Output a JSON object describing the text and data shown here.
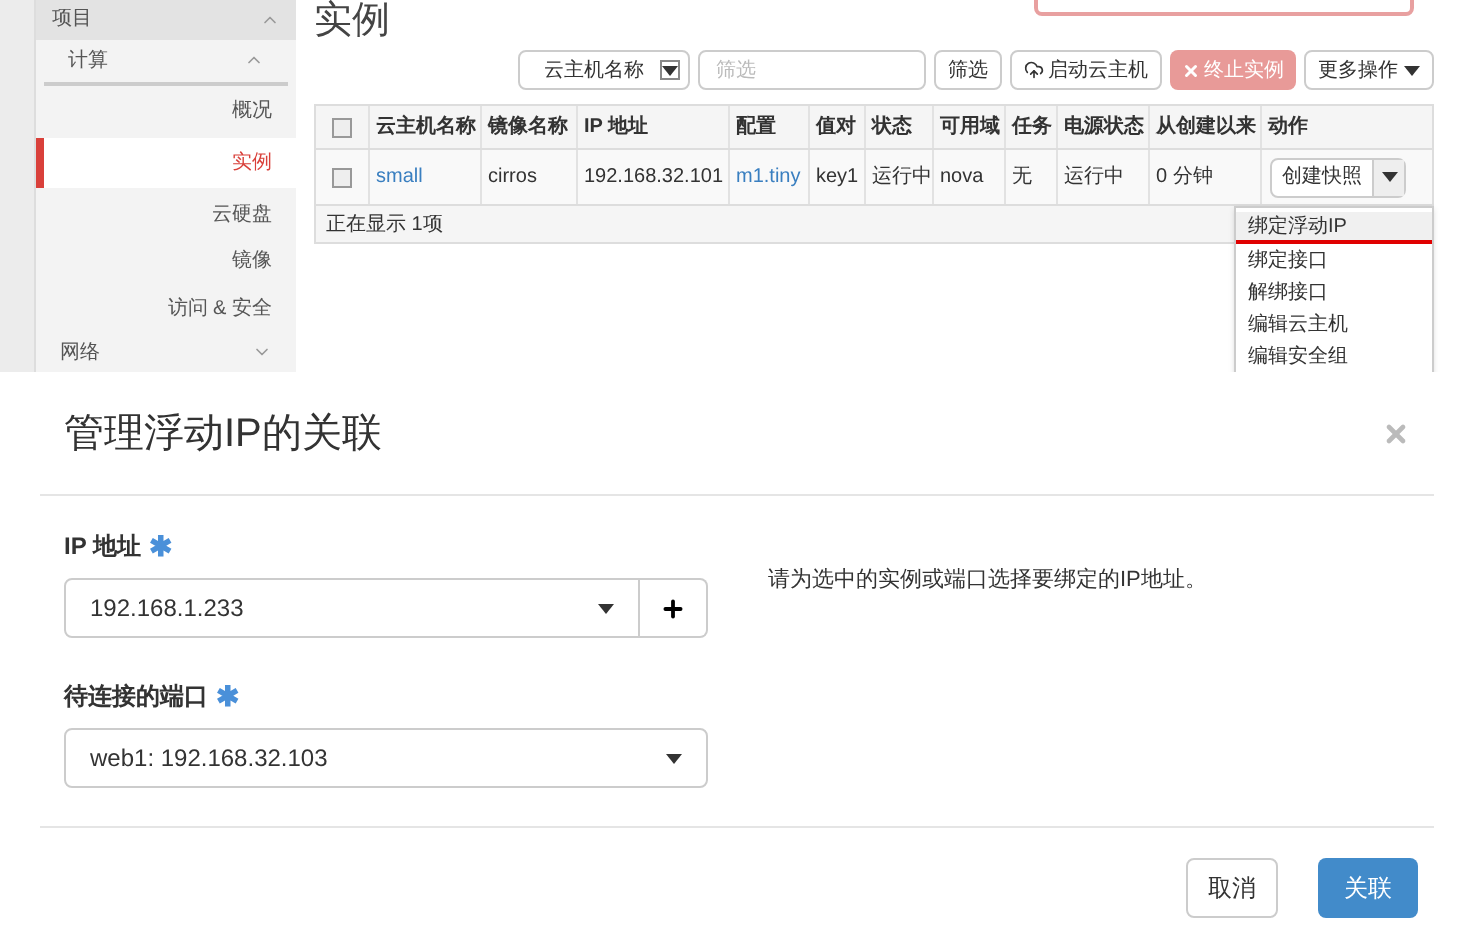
{
  "sidebar": {
    "label": "项目",
    "expanded": true,
    "children": [
      {
        "label": "计算",
        "expanded": true,
        "children": [
          {
            "label": "概况",
            "selected": false
          },
          {
            "label": "实例",
            "selected": true
          },
          {
            "label": "云硬盘",
            "selected": false
          },
          {
            "label": "镜像",
            "selected": false
          },
          {
            "label": "访问 & 安全",
            "selected": false
          }
        ]
      },
      {
        "label": "网络",
        "expanded": false
      }
    ]
  },
  "page_title": "实例",
  "toolbar": {
    "filter_field_select": "云主机名称",
    "filter_placeholder": "筛选",
    "filter_button": "筛选",
    "launch_button": "启动云主机",
    "terminate_button": {
      "label": "终止实例",
      "disabled": true
    },
    "more_button": "更多操作"
  },
  "table": {
    "all_checked": false,
    "columns": [
      "云主机名称",
      "镜像名称",
      "IP 地址",
      "配置",
      "值对",
      "状态",
      "可用域",
      "任务",
      "电源状态",
      "从创建以来",
      "动作"
    ],
    "rows": [
      {
        "checked": false,
        "cells": [
          "small",
          "cirros",
          "192.168.32.101",
          "m1.tiny",
          "key1",
          "运行中",
          "nova",
          "无",
          "运行中",
          "0 分钟"
        ],
        "action": "创建快照"
      }
    ],
    "footer": "正在显示 1项"
  },
  "action_menu": [
    {
      "label": "绑定浮动IP",
      "highlighted": true
    },
    {
      "label": "绑定接口",
      "highlighted": false
    },
    {
      "label": "解绑接口",
      "highlighted": false
    },
    {
      "label": "编辑云主机",
      "highlighted": false
    },
    {
      "label": "编辑安全组",
      "highlighted": false
    }
  ],
  "modal": {
    "title": "管理浮动IP的关联",
    "ip_label": "IP 地址",
    "ip_required": "✱",
    "ip_value": "192.168.1.233",
    "help_text": "请为选中的实例或端口选择要绑定的IP地址。",
    "port_label": "待连接的端口",
    "port_required": "✱",
    "port_value": "web1: 192.168.32.103",
    "buttons": [
      {
        "label": "取消",
        "kind": "default"
      },
      {
        "label": "关联",
        "kind": "primary"
      }
    ]
  }
}
